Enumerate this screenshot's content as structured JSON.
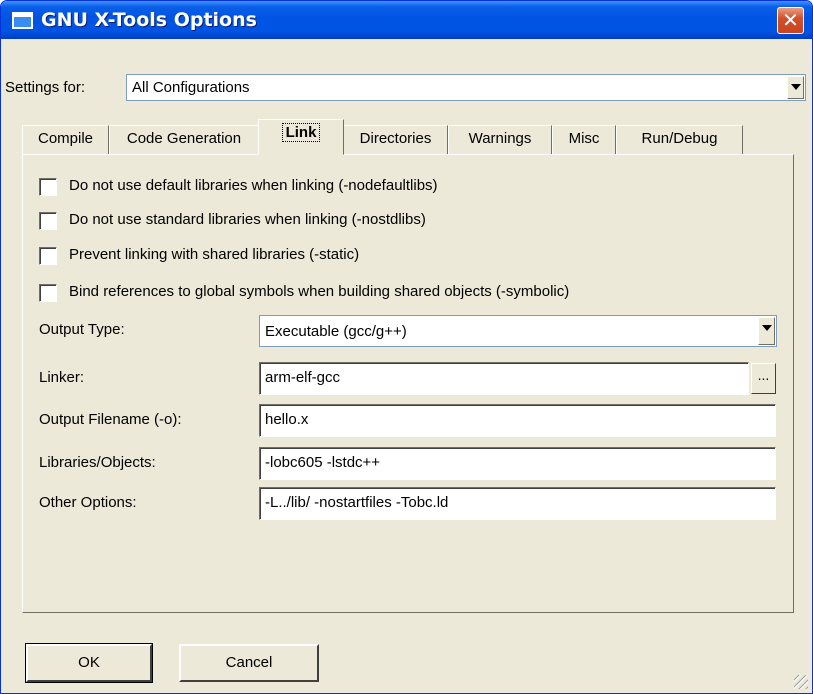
{
  "window": {
    "title": "GNU X-Tools Options",
    "close_label": "✕"
  },
  "settings_for": {
    "label": "Settings for:",
    "value": "All Configurations"
  },
  "tabs": [
    {
      "label": "Compile"
    },
    {
      "label": "Code Generation"
    },
    {
      "label": "Link",
      "active": true
    },
    {
      "label": "Directories"
    },
    {
      "label": "Warnings"
    },
    {
      "label": "Misc"
    },
    {
      "label": "Run/Debug"
    }
  ],
  "link": {
    "checkboxes": [
      {
        "label": "Do not use default libraries when linking (-nodefaultlibs)",
        "checked": false
      },
      {
        "label": "Do not use standard libraries when linking (-nostdlibs)",
        "checked": false
      },
      {
        "label": "Prevent linking with shared libraries (-static)",
        "checked": false
      },
      {
        "label": "Bind references to global symbols when building shared objects (-symbolic)",
        "checked": false
      }
    ],
    "output_type": {
      "label": "Output Type:",
      "value": "Executable (gcc/g++)"
    },
    "linker": {
      "label": "Linker:",
      "value": "arm-elf-gcc",
      "browse_label": "..."
    },
    "output_filename": {
      "label": "Output Filename (-o):",
      "value": "hello.x"
    },
    "libraries_objects": {
      "label": "Libraries/Objects:",
      "value": "-lobc605 -lstdc++"
    },
    "other_options": {
      "label": "Other Options:",
      "value": "-L../lib/ -nostartfiles -Tobc.ld"
    }
  },
  "buttons": {
    "ok": "OK",
    "cancel": "Cancel"
  }
}
